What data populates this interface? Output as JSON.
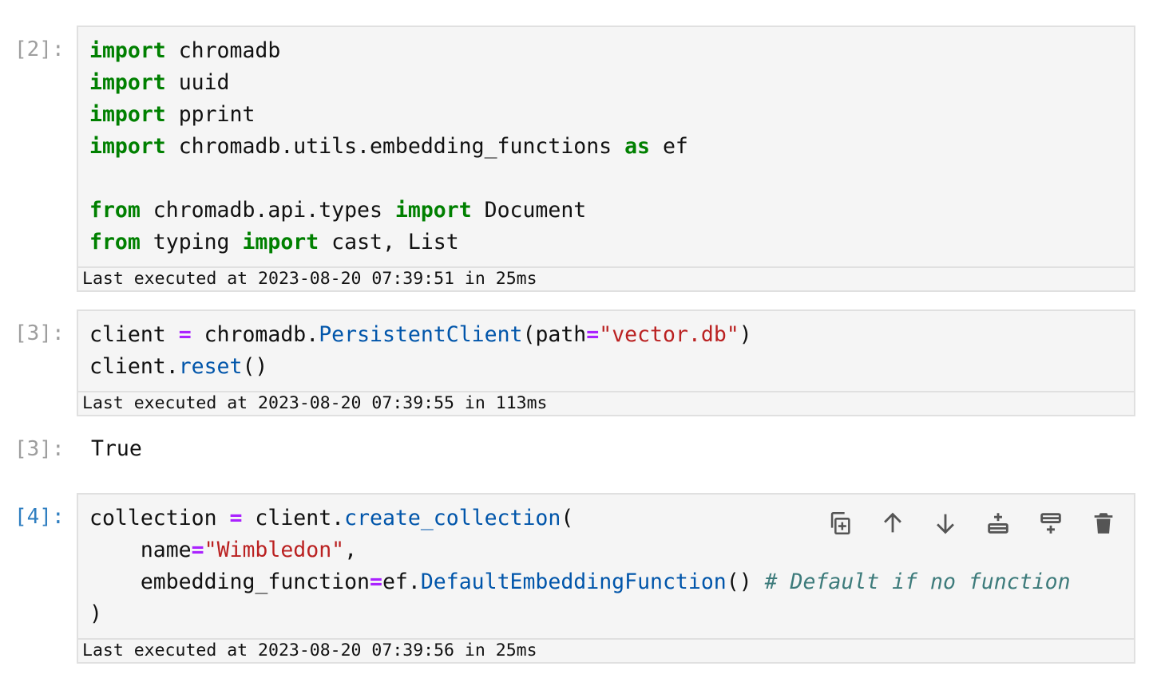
{
  "cells": [
    {
      "prompt": "[2]:",
      "code_lines": [
        [
          {
            "t": "import",
            "c": "kw"
          },
          {
            "t": " chromadb"
          }
        ],
        [
          {
            "t": "import",
            "c": "kw"
          },
          {
            "t": " uuid"
          }
        ],
        [
          {
            "t": "import",
            "c": "kw"
          },
          {
            "t": " pprint"
          }
        ],
        [
          {
            "t": "import",
            "c": "kw"
          },
          {
            "t": " chromadb.utils.embedding_functions "
          },
          {
            "t": "as",
            "c": "kw"
          },
          {
            "t": " ef"
          }
        ],
        [],
        [
          {
            "t": "from",
            "c": "kw"
          },
          {
            "t": " chromadb.api.types "
          },
          {
            "t": "import",
            "c": "kw"
          },
          {
            "t": " Document"
          }
        ],
        [
          {
            "t": "from",
            "c": "kw"
          },
          {
            "t": " typing "
          },
          {
            "t": "import",
            "c": "kw"
          },
          {
            "t": " cast, List"
          }
        ]
      ],
      "exec_info": "Last executed at 2023-08-20 07:39:51 in 25ms"
    },
    {
      "prompt": "[3]:",
      "code_lines": [
        [
          {
            "t": "client "
          },
          {
            "t": "=",
            "c": "op"
          },
          {
            "t": " chromadb."
          },
          {
            "t": "PersistentClient",
            "c": "fn"
          },
          {
            "t": "(path"
          },
          {
            "t": "=",
            "c": "op"
          },
          {
            "t": "\"vector.db\"",
            "c": "str"
          },
          {
            "t": ")"
          }
        ],
        [
          {
            "t": "client."
          },
          {
            "t": "reset",
            "c": "fn"
          },
          {
            "t": "()"
          }
        ]
      ],
      "exec_info": "Last executed at 2023-08-20 07:39:55 in 113ms",
      "output_prompt": "[3]:",
      "output": "True"
    },
    {
      "prompt": "[4]:",
      "code_lines": [
        [
          {
            "t": "collection "
          },
          {
            "t": "=",
            "c": "op"
          },
          {
            "t": " client."
          },
          {
            "t": "create_collection",
            "c": "fn"
          },
          {
            "t": "("
          }
        ],
        [
          {
            "t": "    name"
          },
          {
            "t": "=",
            "c": "op"
          },
          {
            "t": "\"Wimbledon\"",
            "c": "str"
          },
          {
            "t": ","
          }
        ],
        [
          {
            "t": "    embedding_function"
          },
          {
            "t": "=",
            "c": "op"
          },
          {
            "t": "ef."
          },
          {
            "t": "DefaultEmbeddingFunction",
            "c": "fn"
          },
          {
            "t": "() "
          },
          {
            "t": "# Default if no function",
            "c": "cm"
          }
        ],
        [
          {
            "t": ")"
          }
        ]
      ],
      "exec_info": "Last executed at 2023-08-20 07:39:56 in 25ms",
      "toolbar": [
        "duplicate-cell-icon",
        "move-up-icon",
        "move-down-icon",
        "insert-below-icon",
        "insert-above-icon",
        "delete-cell-icon"
      ]
    }
  ],
  "colors": {
    "keyword": "#008000",
    "operator": "#aa22ff",
    "function": "#0055aa",
    "string": "#ba2121",
    "comment": "#3d7b7b",
    "prompt": "#9e9e9e",
    "active_prompt": "#307fc1"
  }
}
